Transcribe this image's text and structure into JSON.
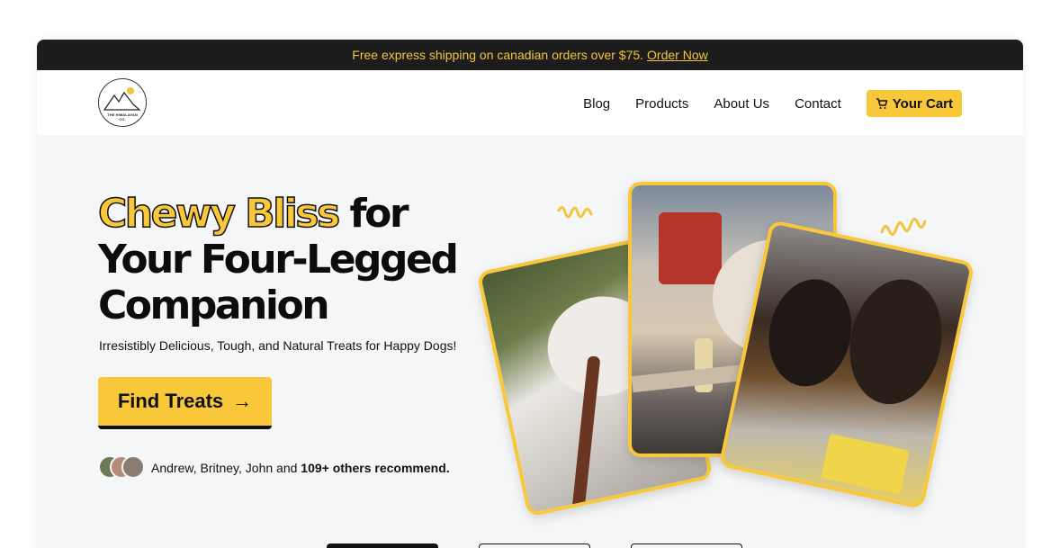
{
  "announcement": {
    "text": "Free express shipping on canadian orders over $75.",
    "link": "Order Now"
  },
  "logo": {
    "text": "THE HIMALAYAN CO."
  },
  "nav": {
    "items": [
      "Blog",
      "Products",
      "About Us",
      "Contact"
    ],
    "cart_label": "Your Cart"
  },
  "hero": {
    "headline_accent": "Chewy Bliss",
    "headline_rest_1": " for",
    "headline_line_2": "Your Four-Legged",
    "headline_line_3": "Companion",
    "subheadline": "Irresistibly Delicious, Tough, and Natural Treats for Happy Dogs!",
    "cta_label": "Find Treats",
    "cta_arrow": "→",
    "social_names": "Andrew, Britney, John and",
    "social_count": "109+ others recommend."
  },
  "colors": {
    "accent": "#f8c83a",
    "dark": "#1d1d1d",
    "background": "#f4f6f8"
  },
  "icons": [
    "cart-icon",
    "arrow-right-icon",
    "squiggle-decoration"
  ]
}
